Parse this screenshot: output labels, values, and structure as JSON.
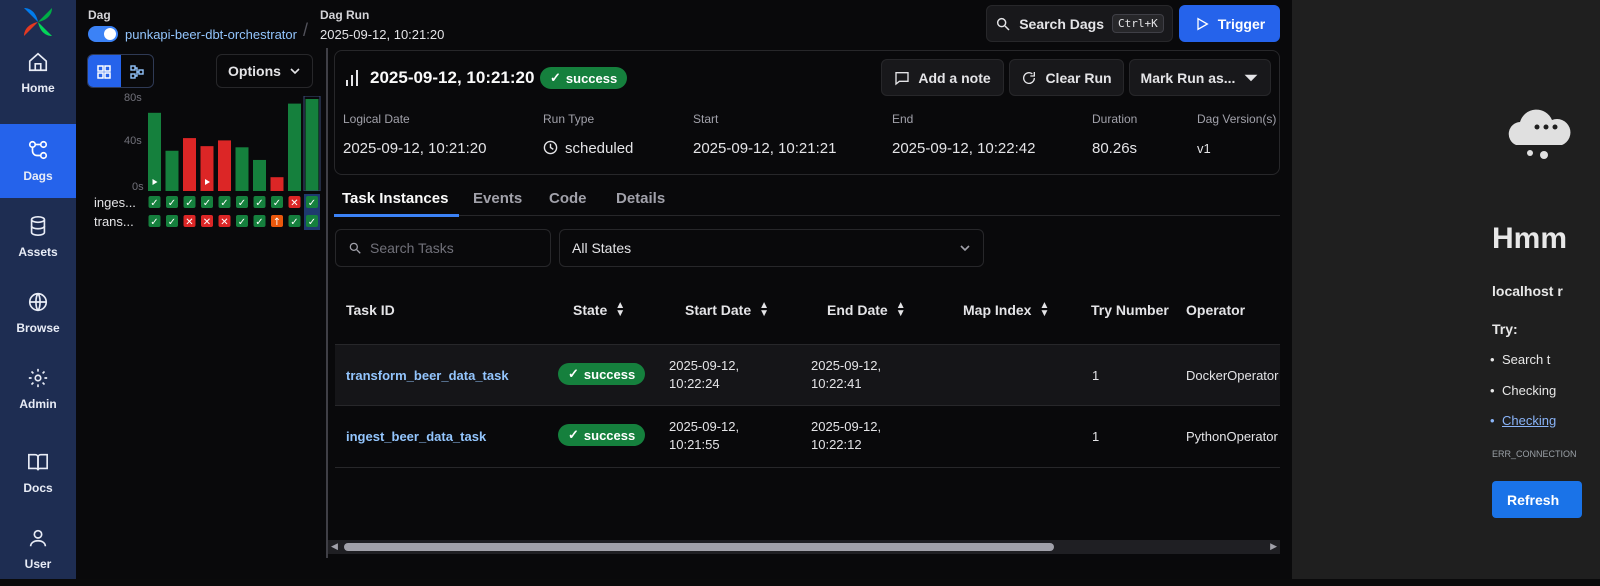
{
  "nav": {
    "items": [
      {
        "label": "Home",
        "icon": "home-icon"
      },
      {
        "label": "Dags",
        "icon": "dags-icon"
      },
      {
        "label": "Assets",
        "icon": "database-icon"
      },
      {
        "label": "Browse",
        "icon": "globe-icon"
      },
      {
        "label": "Admin",
        "icon": "gear-icon"
      },
      {
        "label": "Docs",
        "icon": "book-icon"
      },
      {
        "label": "User",
        "icon": "user-icon"
      }
    ]
  },
  "header": {
    "dag_label": "Dag",
    "dag_name": "punkapi-beer-dbt-orchestrator",
    "run_label": "Dag Run",
    "run_value": "2025-09-12, 10:21:20",
    "search_label": "Search Dags",
    "search_shortcut": "Ctrl+K",
    "trigger_label": "Trigger"
  },
  "grid": {
    "options_label": "Options",
    "axis": [
      "80s",
      "40s",
      "0s"
    ],
    "tasks": [
      "inges...",
      "trans..."
    ],
    "bars": [
      {
        "value": 68,
        "color": "#15803d",
        "play": true
      },
      {
        "value": 35,
        "color": "#15803d",
        "play": false
      },
      {
        "value": 46,
        "color": "#dc2626",
        "play": false
      },
      {
        "value": 39,
        "color": "#dc2626",
        "play": true
      },
      {
        "value": 44,
        "color": "#dc2626",
        "play": false
      },
      {
        "value": 38,
        "color": "#15803d",
        "play": false
      },
      {
        "value": 27,
        "color": "#15803d",
        "play": false
      },
      {
        "value": 12,
        "color": "#dc2626",
        "play": false
      },
      {
        "value": 76,
        "color": "#15803d",
        "play": false
      },
      {
        "value": 80,
        "color": "#15803d",
        "play": false
      }
    ],
    "ingest_states": [
      "success",
      "success",
      "success",
      "success",
      "success",
      "success",
      "success",
      "success",
      "failed",
      "success"
    ],
    "transform_states": [
      "success",
      "success",
      "failed",
      "failed",
      "failed",
      "success",
      "success",
      "upstream_failed",
      "success",
      "success"
    ]
  },
  "run": {
    "title": "2025-09-12, 10:21:20",
    "state": "success",
    "add_note": "Add a note",
    "clear_run": "Clear Run",
    "mark_run": "Mark Run as...",
    "meta": [
      {
        "label": "Logical Date",
        "value": "2025-09-12, 10:21:20"
      },
      {
        "label": "Run Type",
        "value": "scheduled"
      },
      {
        "label": "Start",
        "value": "2025-09-12, 10:21:21"
      },
      {
        "label": "End",
        "value": "2025-09-12, 10:22:42"
      },
      {
        "label": "Duration",
        "value": "80.26s"
      },
      {
        "label": "Dag Version(s)",
        "value": "v1"
      }
    ]
  },
  "tabs": [
    "Task Instances",
    "Events",
    "Code",
    "Details"
  ],
  "filters": {
    "search_placeholder": "Search Tasks",
    "state_value": "All States"
  },
  "table": {
    "columns": [
      "Task ID",
      "State",
      "Start Date",
      "End Date",
      "Map Index",
      "Try Number",
      "Operator"
    ],
    "rows": [
      {
        "task_id": "transform_beer_data_task",
        "state": "success",
        "start_1": "2025-09-12,",
        "start_2": "10:22:24",
        "end_1": "2025-09-12,",
        "end_2": "10:22:41",
        "map_index": "",
        "try": "1",
        "operator": "DockerOperator"
      },
      {
        "task_id": "ingest_beer_data_task",
        "state": "success",
        "start_1": "2025-09-12,",
        "start_2": "10:21:55",
        "end_1": "2025-09-12,",
        "end_2": "10:22:12",
        "map_index": "",
        "try": "1",
        "operator": "PythonOperator"
      }
    ]
  },
  "error_page": {
    "title": "Hmm",
    "host": "localhost r",
    "try": "Try:",
    "items": [
      "Search t",
      "Checking",
      "Checking"
    ],
    "code": "ERR_CONNECTION",
    "refresh": "Refresh"
  },
  "colors": {
    "nav_bg": "#1e2d52",
    "accent": "#2563eb",
    "success": "#15803d",
    "failed": "#dc2626",
    "upstream_failed": "#ea580c"
  }
}
